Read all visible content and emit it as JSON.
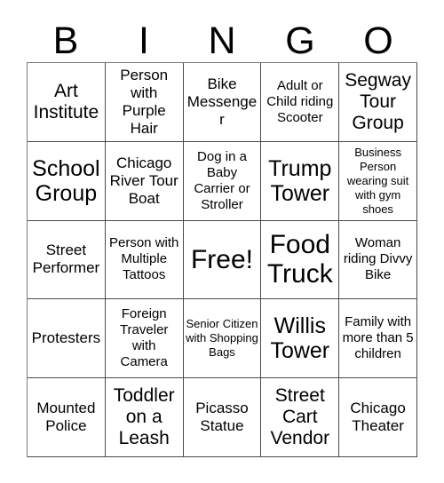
{
  "card": {
    "header_letters": [
      "B",
      "I",
      "N",
      "G",
      "O"
    ],
    "columns": 5,
    "rows": 5,
    "text_color": "#000000",
    "background_color": "#ffffff",
    "border_color": "#4a4a4a"
  },
  "cells": [
    {
      "text": "Art Institute",
      "size": "lg"
    },
    {
      "text": "Person with Purple Hair",
      "size": "md"
    },
    {
      "text": "Bike Messenger",
      "size": "md"
    },
    {
      "text": "Adult or Child riding Scooter",
      "size": "sm"
    },
    {
      "text": "Segway Tour Group",
      "size": "lg"
    },
    {
      "text": "School Group",
      "size": "xl"
    },
    {
      "text": "Chicago River Tour Boat",
      "size": "md"
    },
    {
      "text": "Dog in a Baby Carrier or Stroller",
      "size": "sm"
    },
    {
      "text": "Trump Tower",
      "size": "xl"
    },
    {
      "text": "Business Person wearing suit with gym shoes",
      "size": "xs"
    },
    {
      "text": "Street Performer",
      "size": "md"
    },
    {
      "text": "Person with Multiple Tattoos",
      "size": "sm"
    },
    {
      "text": "Free!",
      "size": "xxl"
    },
    {
      "text": "Food Truck",
      "size": "xxl"
    },
    {
      "text": "Woman riding Divvy Bike",
      "size": "sm"
    },
    {
      "text": "Protesters",
      "size": "md"
    },
    {
      "text": "Foreign Traveler with Camera",
      "size": "sm"
    },
    {
      "text": "Senior Citizen with Shopping Bags",
      "size": "xs"
    },
    {
      "text": "Willis Tower",
      "size": "xl"
    },
    {
      "text": "Family with more than 5 children",
      "size": "sm"
    },
    {
      "text": "Mounted Police",
      "size": "md"
    },
    {
      "text": "Toddler on a Leash",
      "size": "lg"
    },
    {
      "text": "Picasso Statue",
      "size": "md"
    },
    {
      "text": "Street Cart Vendor",
      "size": "lg"
    },
    {
      "text": "Chicago Theater",
      "size": "md"
    }
  ]
}
